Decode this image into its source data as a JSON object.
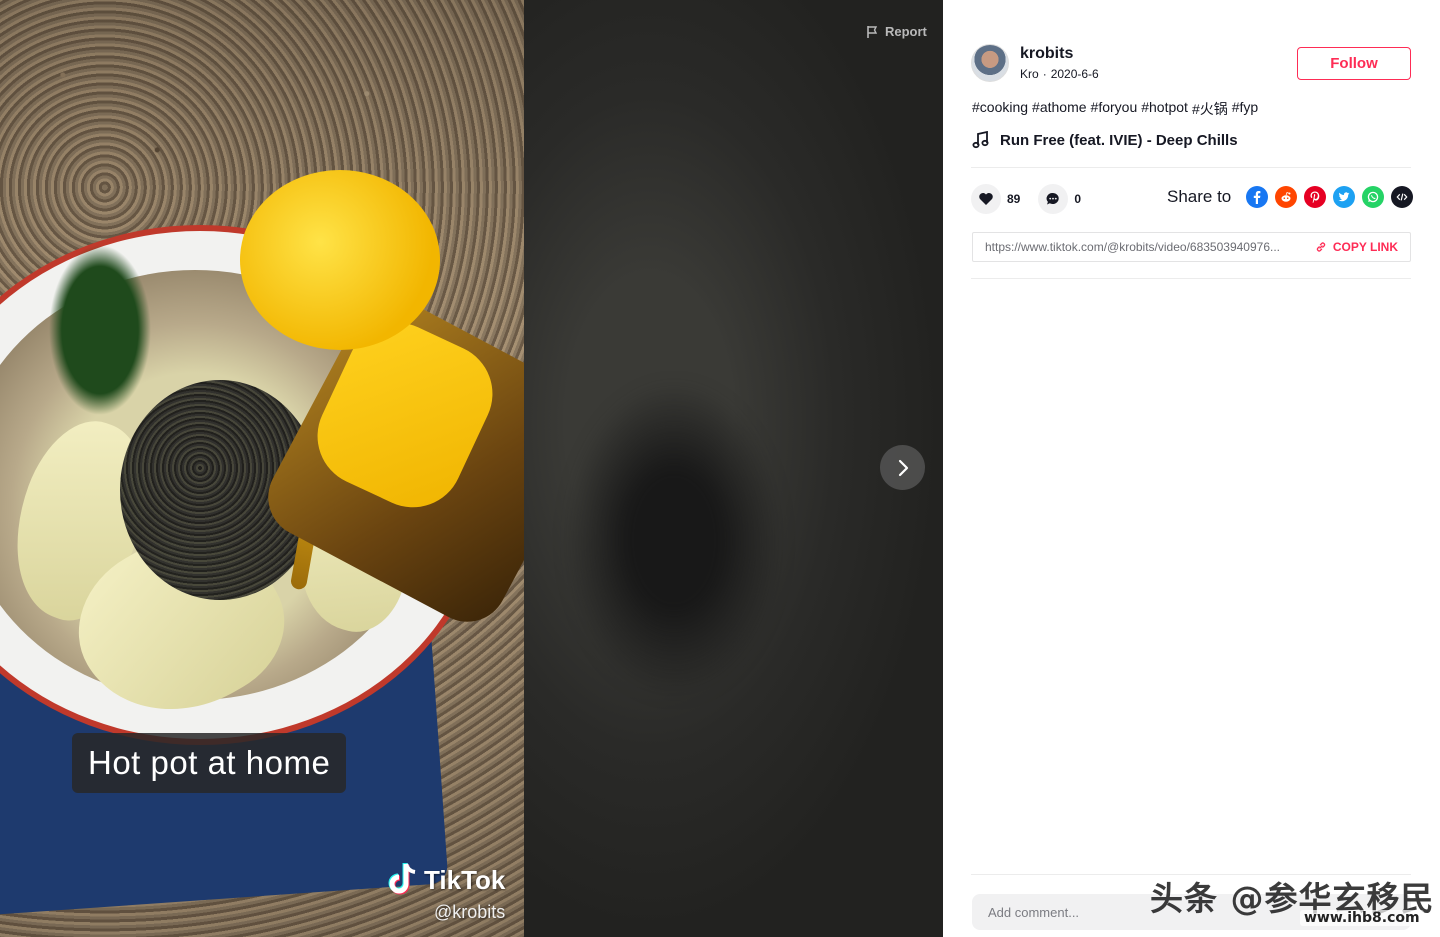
{
  "video": {
    "caption": "Hot pot at home",
    "watermark_brand": "TikTok",
    "watermark_handle": "@krobits",
    "report_label": "Report"
  },
  "author": {
    "username": "krobits",
    "nickname": "Kro",
    "separator": "·",
    "date": "2020-6-6",
    "follow_label": "Follow"
  },
  "description": {
    "hashtags": [
      "#cooking",
      "#athome",
      "#foryou",
      "#hotpot",
      "#火锅",
      "#fyp"
    ]
  },
  "music": {
    "title": "Run Free (feat. IVIE) - Deep Chills",
    "icon": "music-note-icon"
  },
  "stats": {
    "likes": "89",
    "comments": "0"
  },
  "share": {
    "label": "Share to",
    "targets": [
      "facebook-icon",
      "reddit-icon",
      "pinterest-icon",
      "twitter-icon",
      "whatsapp-icon",
      "embed-icon"
    ]
  },
  "link": {
    "url": "https://www.tiktok.com/@krobits/video/683503940976...",
    "copy_label": "COPY LINK"
  },
  "comment": {
    "placeholder": "Add comment..."
  },
  "overlay": {
    "corner_mark": "头条 @参华玄移民",
    "corner_sub": "www.ihb8.com"
  },
  "colors": {
    "accent": "#fe2c55",
    "text": "#161823",
    "muted": "#6b6c72"
  }
}
